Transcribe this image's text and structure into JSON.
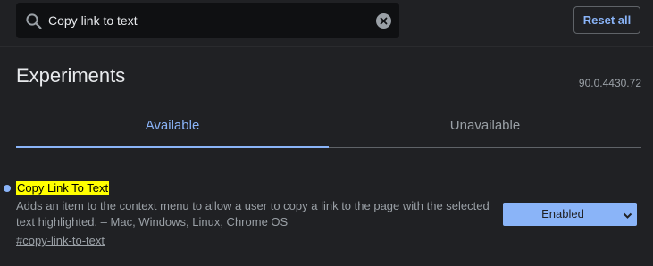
{
  "search": {
    "value": "Copy link to text",
    "icon": "search-icon",
    "clear_icon": "clear-icon"
  },
  "header": {
    "reset_label": "Reset all",
    "title": "Experiments",
    "version": "90.0.4430.72"
  },
  "tabs": [
    {
      "label": "Available",
      "active": true
    },
    {
      "label": "Unavailable",
      "active": false
    }
  ],
  "experiment": {
    "title": "Copy Link To Text",
    "description": "Adds an item to the context menu to allow a user to copy a link to the page with the selected text highlighted. – Mac, Windows, Linux, Chrome OS",
    "link": "#copy-link-to-text",
    "state": "Enabled"
  },
  "colors": {
    "background": "#202124",
    "accent": "#8ab4f8",
    "highlight": "#ffff00",
    "muted_text": "#9aa0a6"
  }
}
